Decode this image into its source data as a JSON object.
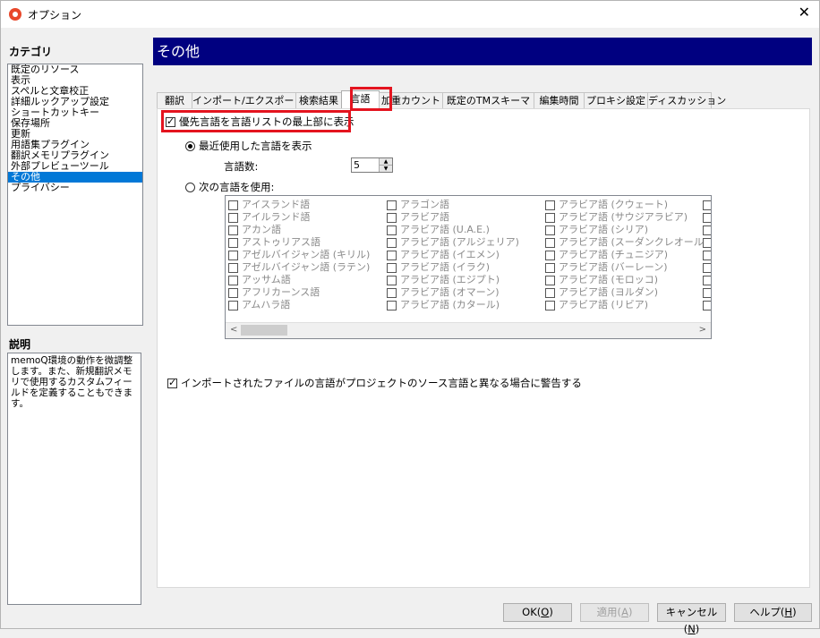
{
  "window": {
    "title": "オプション",
    "close_glyph": "✕"
  },
  "category": {
    "heading": "カテゴリ",
    "items": [
      "既定のリソース",
      "表示",
      "スペルと文章校正",
      "詳細ルックアップ設定",
      "ショートカットキー",
      "保存場所",
      "更新",
      "用語集プラグイン",
      "翻訳メモリプラグイン",
      "外部プレビューツール",
      "その他",
      "プライバシー"
    ],
    "selected_index": 10
  },
  "description": {
    "heading": "説明",
    "text": "memoQ環境の動作を微調整します。また、新規翻訳メモリで使用するカスタムフィールドを定義することもできます。"
  },
  "header": {
    "title": "その他"
  },
  "tabs": [
    "翻訳",
    "インポート/エクスポート",
    "検索結果",
    "言語",
    "加重カウント",
    "既定のTMスキーマ",
    "編集時間",
    "プロキシ設定",
    "ディスカッション"
  ],
  "active_tab_index": 3,
  "options": {
    "prefer_top": {
      "label": "優先言語を言語リストの最上部に表示",
      "checked": true
    },
    "recent": {
      "label": "最近使用した言語を表示",
      "selected": true
    },
    "count_label": "言語数:",
    "count_value": "5",
    "use_following": {
      "label": "次の言語を使用:",
      "selected": false
    },
    "warn_import": {
      "label": "インポートされたファイルの言語がプロジェクトのソース言語と異なる場合に警告する",
      "checked": true
    }
  },
  "languages": {
    "col1": [
      "アイスランド語",
      "アイルランド語",
      "アカン語",
      "アストゥリアス語",
      "アゼルバイジャン語 (キリル)",
      "アゼルバイジャン語 (ラテン)",
      "アッサム語",
      "アフリカーンス語",
      "アムハラ語"
    ],
    "col2": [
      "アラゴン語",
      "アラビア語",
      "アラビア語 (U.A.E.)",
      "アラビア語 (アルジェリア)",
      "アラビア語 (イエメン)",
      "アラビア語 (イラク)",
      "アラビア語 (エジプト)",
      "アラビア語 (オマーン)",
      "アラビア語 (カタール)"
    ],
    "col3": [
      "アラビア語 (クウェート)",
      "アラビア語 (サウジアラビア)",
      "アラビア語 (シリア)",
      "アラビア語 (スーダンクレオール)",
      "アラビア語 (チュニジア)",
      "アラビア語 (バーレーン)",
      "アラビア語 (モロッコ)",
      "アラビア語 (ヨルダン)",
      "アラビア語 (リビア)"
    ]
  },
  "scroll": {
    "left_glyph": "<",
    "right_glyph": ">"
  },
  "buttons": {
    "ok": {
      "label": "OK(",
      "key": "O",
      "tail": ")"
    },
    "apply": {
      "label": "適用(",
      "key": "A",
      "tail": ")"
    },
    "cancel": {
      "label": "キャンセル(",
      "key": "N",
      "tail": ")"
    },
    "help": {
      "label": "ヘルプ(",
      "key": "H",
      "tail": ")"
    }
  },
  "colors": {
    "header_bg": "#000080",
    "selection": "#0078d7",
    "highlight": "#e4141f"
  }
}
